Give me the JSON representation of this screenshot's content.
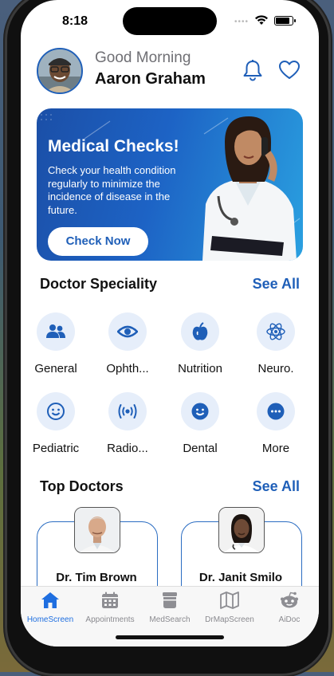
{
  "status_bar": {
    "time": "8:18"
  },
  "header": {
    "greeting": "Good Morning",
    "user_name": "Aaron Graham"
  },
  "banner": {
    "title": "Medical Checks!",
    "description": "Check your health condition regularly to minimize the incidence of disease in the future.",
    "button_label": "Check Now"
  },
  "specialities": {
    "title": "Doctor Speciality",
    "see_all": "See All",
    "items": [
      {
        "label": "General",
        "icon": "people-icon"
      },
      {
        "label": "Ophth...",
        "icon": "eye-icon"
      },
      {
        "label": "Nutrition",
        "icon": "apple-icon"
      },
      {
        "label": "Neuro.",
        "icon": "atom-icon"
      },
      {
        "label": "Pediatric",
        "icon": "smile-icon"
      },
      {
        "label": "Radio...",
        "icon": "radio-waves-icon"
      },
      {
        "label": "Dental",
        "icon": "smile-filled-icon"
      },
      {
        "label": "More",
        "icon": "more-dots-icon"
      }
    ]
  },
  "top_doctors": {
    "title": "Top Doctors",
    "see_all": "See All",
    "items": [
      {
        "name": "Dr. Tim Brown"
      },
      {
        "name": "Dr. Janit Smilo"
      }
    ]
  },
  "tab_bar": {
    "items": [
      {
        "label": "HomeScreen",
        "icon": "home-icon",
        "active": true
      },
      {
        "label": "Appointments",
        "icon": "calendar-icon",
        "active": false
      },
      {
        "label": "MedSearch",
        "icon": "medicine-jar-icon",
        "active": false
      },
      {
        "label": "DrMapScreen",
        "icon": "map-icon",
        "active": false
      },
      {
        "label": "AiDoc",
        "icon": "robot-icon",
        "active": false
      }
    ]
  },
  "colors": {
    "accent": "#1f5fb8",
    "icon_bg": "#e6eefa",
    "active_tab": "#1f6fe0"
  }
}
